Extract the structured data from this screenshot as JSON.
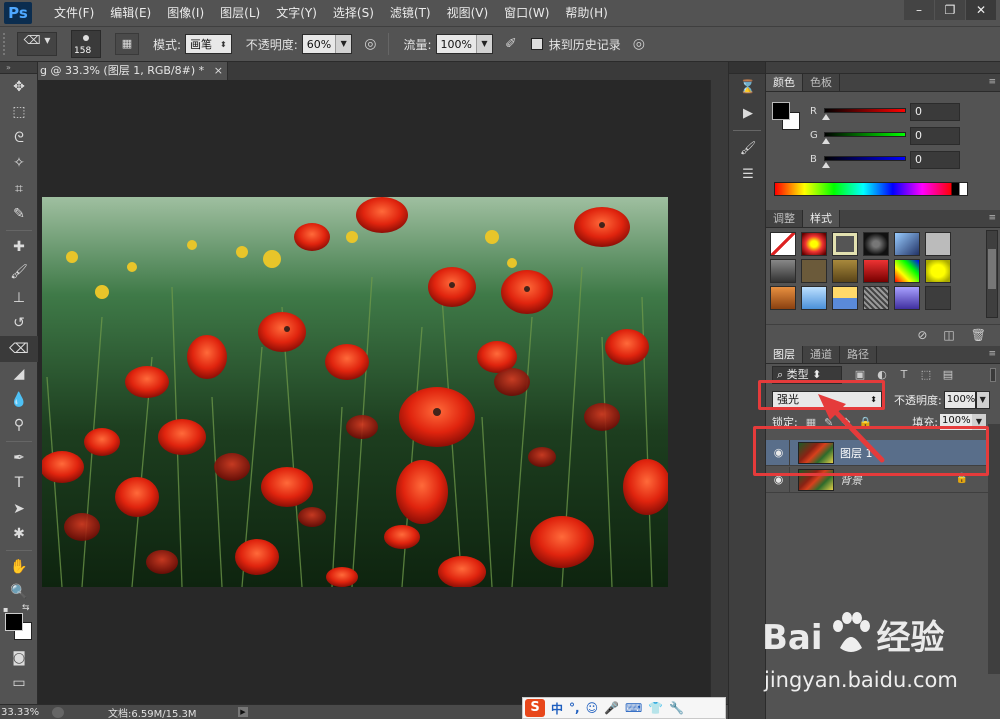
{
  "app": {
    "logo": "Ps",
    "menu": [
      "文件(F)",
      "编辑(E)",
      "图像(I)",
      "图层(L)",
      "文字(Y)",
      "选择(S)",
      "滤镜(T)",
      "视图(V)",
      "窗口(W)",
      "帮助(H)"
    ],
    "window_controls": [
      "minimize-icon",
      "restore-icon",
      "close-icon"
    ]
  },
  "options_bar": {
    "brush_size": "158",
    "mode_label": "模式:",
    "mode_value": "画笔",
    "opacity_label": "不透明度:",
    "opacity_value": "60%",
    "flow_label": "流量:",
    "flow_value": "100%",
    "erase_history_label": "抹到历史记录"
  },
  "document": {
    "tab_title": "g @ 33.3% (图层 1, RGB/8#) *",
    "tab_close": "×",
    "zoom": "33.33%",
    "doc_info": "文档:6.59M/15.3M"
  },
  "color_panel": {
    "tabs": [
      "颜色",
      "色板"
    ],
    "channels": [
      {
        "label": "R",
        "value": "0",
        "color": "#d92b2b"
      },
      {
        "label": "G",
        "value": "0",
        "color": "#2fbf2f"
      },
      {
        "label": "B",
        "value": "0",
        "color": "#2b52d9"
      }
    ]
  },
  "styles_panel": {
    "tabs": [
      "调整",
      "样式"
    ]
  },
  "layers_panel": {
    "tabs": [
      "图层",
      "通道",
      "路径"
    ],
    "filter_label": "类型",
    "blend_mode": "强光",
    "opacity_label": "不透明度:",
    "opacity_value": "100%",
    "lock_label": "锁定:",
    "fill_label": "填充:",
    "fill_value": "100%",
    "layers": [
      {
        "name": "图层 1",
        "selected": true
      },
      {
        "name": "背景",
        "selected": false
      }
    ]
  },
  "watermark": {
    "logo": "Bai",
    "logo_suffix": "经验",
    "url": "jingyan.baidu.com"
  },
  "ime": {
    "items": [
      "中",
      "°,",
      "☺",
      "🎤",
      "⌨",
      "👕",
      "🔧"
    ]
  }
}
